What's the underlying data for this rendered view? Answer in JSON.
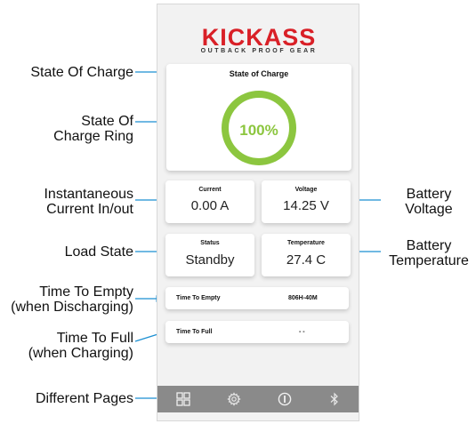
{
  "callouts": {
    "state_of_charge": "State Of Charge",
    "state_of_charge_ring_line1": "State Of",
    "state_of_charge_ring_line2": "Charge Ring",
    "current_line1": "Instantaneous",
    "current_line2": "Current In/out",
    "battery_voltage_line1": "Battery",
    "battery_voltage_line2": "Voltage",
    "load_state": "Load State",
    "battery_temperature_line1": "Battery",
    "battery_temperature_line2": "Temperature",
    "time_to_empty_line1": "Time To Empty",
    "time_to_empty_line2": "(when Discharging)",
    "time_to_full_line1": "Time To Full",
    "time_to_full_line2": "(when Charging)",
    "different_pages": "Different Pages"
  },
  "logo": {
    "main": "KICKASS",
    "sub": "OUTBACK PROOF GEAR"
  },
  "soc": {
    "title": "State of Charge",
    "value": "100%",
    "fraction": 1.0
  },
  "metrics": {
    "current": {
      "label": "Current",
      "value": "0.00 A"
    },
    "voltage": {
      "label": "Voltage",
      "value": "14.25 V"
    },
    "status": {
      "label": "Status",
      "value": "Standby"
    },
    "temperature": {
      "label": "Temperature",
      "value": "27.4 C"
    }
  },
  "rows": {
    "time_to_empty": {
      "label": "Time To Empty",
      "value": "806H-40M"
    },
    "time_to_full": {
      "label": "Time To Full",
      "value": "- -"
    }
  },
  "nav": {
    "items": [
      "grid-icon",
      "gear-icon",
      "info-icon",
      "bluetooth-icon"
    ]
  },
  "colors": {
    "ring": "#8cc63f",
    "brand": "#d92027",
    "callout_arrow": "#1b8fd2",
    "navbar": "#8a8a8a"
  }
}
